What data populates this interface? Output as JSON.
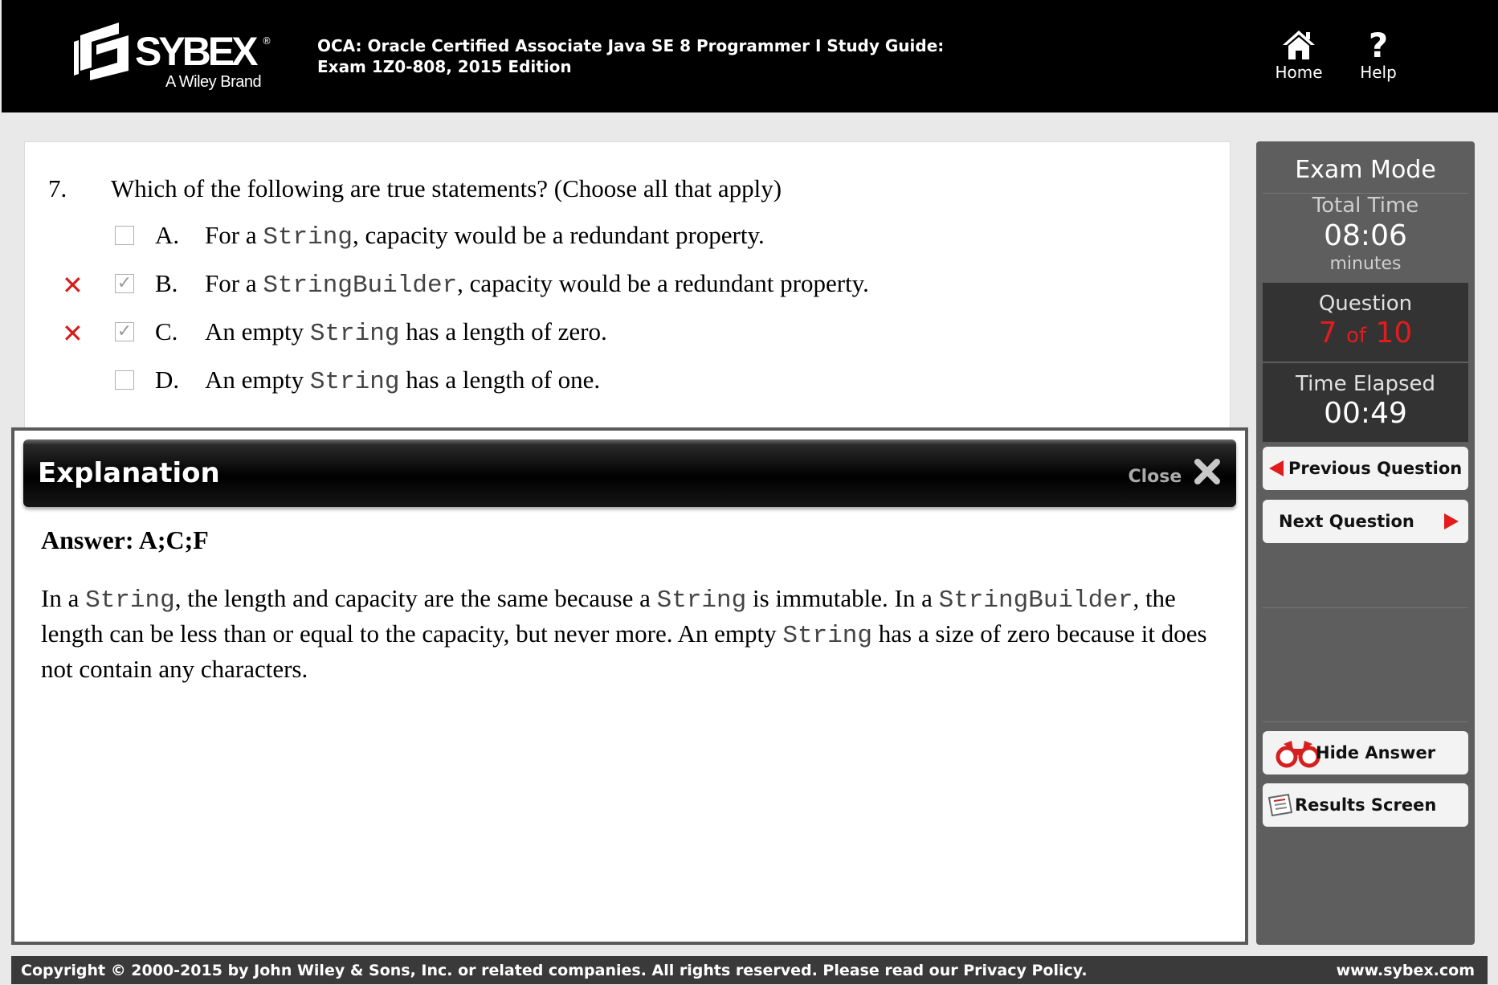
{
  "header": {
    "logo_word": "SYBEX",
    "logo_tagline": "A Wiley Brand",
    "title_line1": "OCA: Oracle Certified Associate Java SE 8 Programmer I Study Guide:",
    "title_line2": "Exam 1Z0-808, 2015 Edition",
    "home_label": "Home",
    "help_label": "Help",
    "help_glyph": "?"
  },
  "question": {
    "number": "7.",
    "text": "Which of the following are true statements? (Choose all that apply)",
    "options": [
      {
        "letter": "A.",
        "pre": "For a ",
        "code": "String",
        "post": ", capacity would be a redundant property.",
        "checked": false,
        "marked_wrong": false
      },
      {
        "letter": "B.",
        "pre": "For a ",
        "code": "StringBuilder",
        "post": ", capacity would be a redundant property.",
        "checked": true,
        "marked_wrong": true
      },
      {
        "letter": "C.",
        "pre": "An empty ",
        "code": "String",
        "post": " has a length of zero.",
        "checked": true,
        "marked_wrong": true
      },
      {
        "letter": "D.",
        "pre": "An empty ",
        "code": "String",
        "post": " has a length of one.",
        "checked": false,
        "marked_wrong": false
      }
    ],
    "wrong_mark": "✕",
    "check_glyph": "✓"
  },
  "explanation": {
    "title": "Explanation",
    "close_label": "Close",
    "answer": "Answer: A;C;F",
    "parts": [
      {
        "t": "In a "
      },
      {
        "c": "String"
      },
      {
        "t": ", the length and capacity are the same because a "
      },
      {
        "c": "String"
      },
      {
        "t": " is immutable. In a "
      },
      {
        "c": "StringBuilder"
      },
      {
        "t": ", the length can be less than or equal to the capacity, but never more. An empty "
      },
      {
        "c": "String"
      },
      {
        "t": " has a size of zero because it does not contain any characters."
      }
    ]
  },
  "sidebar": {
    "mode_title": "Exam Mode",
    "total_time_label": "Total Time",
    "total_time_value": "08:06",
    "total_time_unit": "minutes",
    "question_label": "Question",
    "question_current": "7",
    "question_of": "of",
    "question_total": "10",
    "elapsed_label": "Time Elapsed",
    "elapsed_value": "00:49",
    "prev_label": "Previous Question",
    "next_label": "Next Question",
    "hide_answer_label": "Hide Answer",
    "results_label": "Results Screen"
  },
  "footer": {
    "copyright": "Copyright © 2000-2015 by John Wiley & Sons, Inc. or related companies. All rights reserved. Please read our Privacy Policy.",
    "url": "www.sybex.com"
  },
  "colors": {
    "accent_red": "#e21c1c",
    "header_bg": "#000000",
    "sidebar_bg": "#5e5e5e"
  }
}
